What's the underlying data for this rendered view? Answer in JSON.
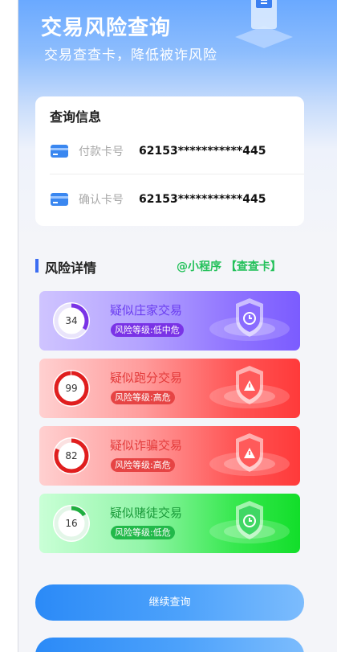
{
  "header": {
    "title": "交易风险查询",
    "subtitle": "交易查查卡，降低被诈风险"
  },
  "query_info": {
    "title": "查询信息",
    "rows": [
      {
        "icon": "bank-card-icon",
        "label": "付款卡号",
        "value": "62153***********445"
      },
      {
        "icon": "bank-card-icon",
        "label": "确认卡号",
        "value": "62153***********445"
      }
    ]
  },
  "risk_section": {
    "title": "风险详情",
    "mini_program": "@小程序 【查查卡】"
  },
  "risk_items": [
    {
      "score": "34",
      "score_fraction": 0.34,
      "title": "疑似庄家交易",
      "level": "风险等级:低中危",
      "color": "#7a33e6",
      "ring_track": "#e9e4fb"
    },
    {
      "score": "99",
      "score_fraction": 0.99,
      "title": "疑似跑分交易",
      "level": "风险等级:高危",
      "color": "#e01e1e",
      "ring_track": "#fbe1e1"
    },
    {
      "score": "82",
      "score_fraction": 0.82,
      "title": "疑似诈骗交易",
      "level": "风险等级:高危",
      "color": "#e01e1e",
      "ring_track": "#fbe1e1"
    },
    {
      "score": "16",
      "score_fraction": 0.16,
      "title": "疑似赌徒交易",
      "level": "风险等级:低危",
      "color": "#1fae3f",
      "ring_track": "#e3f6e8"
    }
  ],
  "buttons": {
    "continue": "继续查询"
  }
}
